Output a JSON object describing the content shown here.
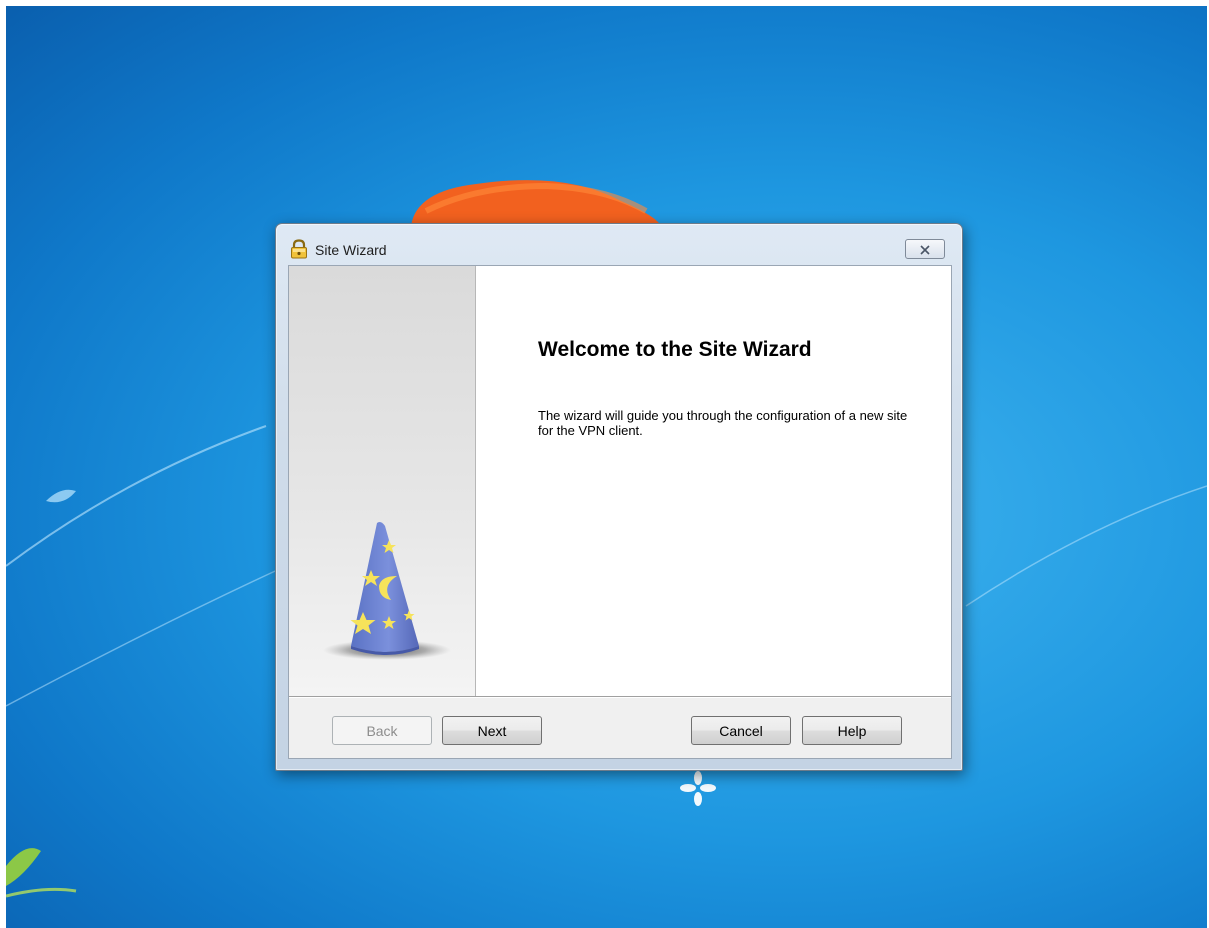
{
  "dialog": {
    "title": "Site Wizard",
    "title_icon": "padlock-icon",
    "close_icon": "close-icon"
  },
  "content": {
    "heading": "Welcome to the Site Wizard",
    "body": "The wizard will guide you through the configuration of a new site for the VPN client.",
    "illustration": "wizard-hat-icon"
  },
  "buttons": {
    "back": "Back",
    "next": "Next",
    "cancel": "Cancel",
    "help": "Help"
  },
  "state": {
    "back_enabled": false
  },
  "colors": {
    "desktop": "#1e97e0",
    "hat": "#6f86d4",
    "stars": "#f6e35a"
  }
}
